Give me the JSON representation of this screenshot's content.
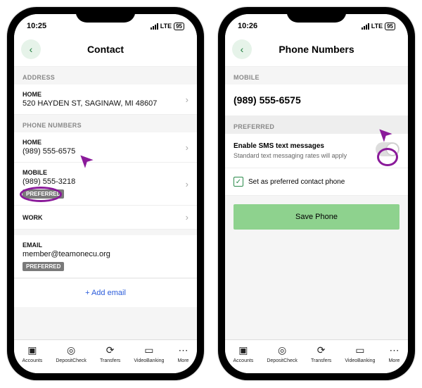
{
  "left": {
    "time": "10:25",
    "net": "LTE",
    "battery": "95",
    "title": "Contact",
    "sections": {
      "addressHeader": "ADDRESS",
      "home": {
        "label": "HOME",
        "value": "520 HAYDEN ST, SAGINAW, MI 48607"
      },
      "phoneHeader": "PHONE NUMBERS",
      "phoneHome": {
        "label": "HOME",
        "value": "(989) 555-6575"
      },
      "phoneMobile": {
        "label": "MOBILE",
        "value": "(989) 555-3218",
        "chip": "PREFERRED"
      },
      "phoneWork": {
        "label": "WORK"
      },
      "email": {
        "label": "EMAIL",
        "value": "member@teamonecu.org",
        "chip": "PREFERRED"
      },
      "addEmail": "+   Add email"
    }
  },
  "right": {
    "time": "10:26",
    "net": "LTE",
    "battery": "95",
    "title": "Phone Numbers",
    "mobileHeader": "MOBILE",
    "mobileNumber": "(989) 555-6575",
    "preferredHeader": "PREFERRED",
    "sms": {
      "title": "Enable SMS text messages",
      "sub": "Standard text messaging rates will apply"
    },
    "prefCheck": "Set as preferred contact phone",
    "saveBtn": "Save Phone"
  },
  "tabs": {
    "accounts": "Accounts",
    "deposit": "DepositCheck",
    "transfers": "Transfers",
    "video": "VideoBanking",
    "more": "More"
  }
}
